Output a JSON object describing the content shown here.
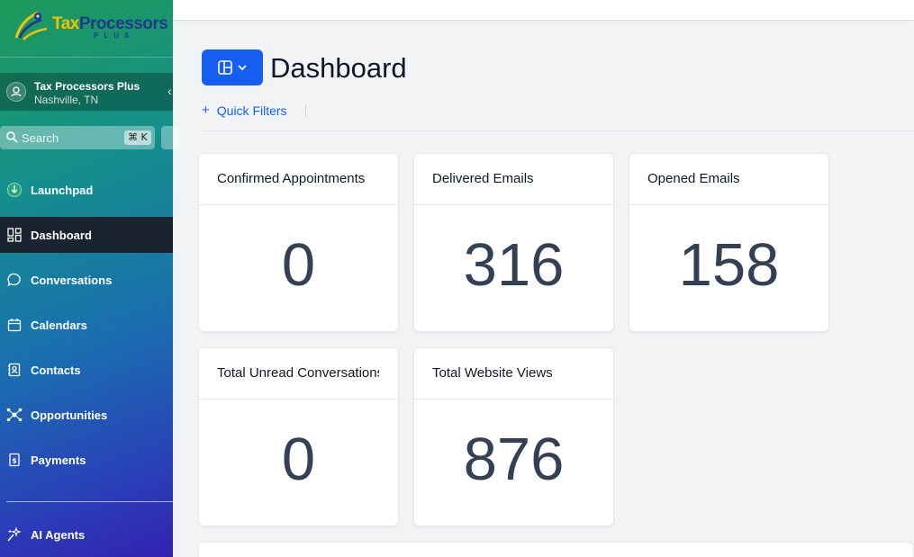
{
  "brand": {
    "name_part1": "Tax",
    "name_part2": "Processors",
    "tagline": "PLUS"
  },
  "account": {
    "name": "Tax Processors Plus",
    "location": "Nashville, TN"
  },
  "search": {
    "placeholder": "Search",
    "shortcut": "⌘ K"
  },
  "nav": {
    "items": [
      {
        "label": "Launchpad",
        "icon": "rocket-icon"
      },
      {
        "label": "Dashboard",
        "icon": "dashboard-grid-icon",
        "active": true
      },
      {
        "label": "Conversations",
        "icon": "chat-icon"
      },
      {
        "label": "Calendars",
        "icon": "calendar-icon"
      },
      {
        "label": "Contacts",
        "icon": "contacts-icon"
      },
      {
        "label": "Opportunities",
        "icon": "opportunities-icon"
      },
      {
        "label": "Payments",
        "icon": "payments-icon"
      }
    ],
    "secondary": [
      {
        "label": "AI Agents",
        "icon": "sparkle-icon"
      }
    ]
  },
  "header": {
    "title": "Dashboard",
    "quick_filters": "Quick Filters"
  },
  "cards": [
    {
      "title": "Confirmed Appointments",
      "value": "0"
    },
    {
      "title": "Delivered Emails",
      "value": "316"
    },
    {
      "title": "Opened Emails",
      "value": "158"
    },
    {
      "title": "Total Unread Conversations",
      "value": "0"
    },
    {
      "title": "Total Website Views",
      "value": "876"
    }
  ],
  "colors": {
    "accent": "#155eef",
    "active_nav": "#1a2330",
    "value_text": "#344054"
  }
}
